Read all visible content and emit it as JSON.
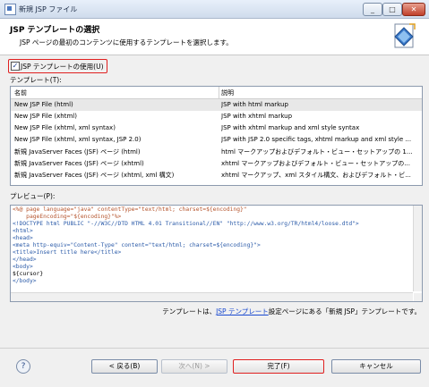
{
  "window": {
    "title": "新規 JSP ファイル"
  },
  "window_controls": {
    "minimize": "_",
    "maximize": "□",
    "close": "✕"
  },
  "header": {
    "title": "JSP テンプレートの選択",
    "description": "JSP ページの最初のコンテンツに使用するテンプレートを選択します。"
  },
  "use_template": {
    "label": "JSP テンプレートの使用(U)",
    "checked": true
  },
  "templates": {
    "label": "テンプレート(T):",
    "columns": [
      "名前",
      "説明"
    ],
    "rows": [
      {
        "name": "New JSP File (html)",
        "desc": "JSP with html markup"
      },
      {
        "name": "New JSP File (xhtml)",
        "desc": "JSP with xhtml markup"
      },
      {
        "name": "New JSP File (xhtml, xml syntax)",
        "desc": "JSP with xhtml markup and xml style syntax"
      },
      {
        "name": "New JSP File (xhtml, xml syntax, JSP 2.0)",
        "desc": "JSP with JSP 2.0 specific tags, xhtml markup and xml style ..."
      },
      {
        "name": "新規 JavaServer Faces (JSF) ページ (html)",
        "desc": "html マークアップおよびデフォルト・ビュー・セットアップの 1..."
      },
      {
        "name": "新規 JavaServer Faces (JSF) ページ (xhtml)",
        "desc": "xhtml マークアップおよびデフォルト・ビュー・セットアップの..."
      },
      {
        "name": "新規 JavaServer Faces (JSF) ページ (xhtml, xml 構文)",
        "desc": "xhtml マークアップ、xml スタイル構文、およびデフォルト・ビ..."
      }
    ],
    "selected_index": 0
  },
  "preview": {
    "label": "プレビュー(P):",
    "lines": [
      "<%@ page language=\"java\" contentType=\"text/html; charset=${encoding}\"",
      "    pageEncoding=\"${encoding}\"%>",
      "<!DOCTYPE html PUBLIC \"-//W3C//DTD HTML 4.01 Transitional//EN\" \"http://www.w3.org/TR/html4/loose.dtd\">",
      "<html>",
      "<head>",
      "<meta http-equiv=\"Content-Type\" content=\"text/html; charset=${encoding}\">",
      "<title>Insert title here</title>",
      "</head>",
      "<body>",
      "${cursor}",
      "</body>"
    ]
  },
  "note": {
    "prefix": "テンプレートは、",
    "link": "JSP テンプレート",
    "suffix": "設定ページにある「新規 JSP」テンプレートです。"
  },
  "footer": {
    "help": "?",
    "back": "< 戻る(B)",
    "next": "次へ(N) >",
    "finish": "完了(F)",
    "cancel": "キャンセル"
  },
  "colors": {
    "accent_red": "#e02020",
    "link_blue": "#1a4ad0",
    "selected_row": "#e8e8e8"
  }
}
